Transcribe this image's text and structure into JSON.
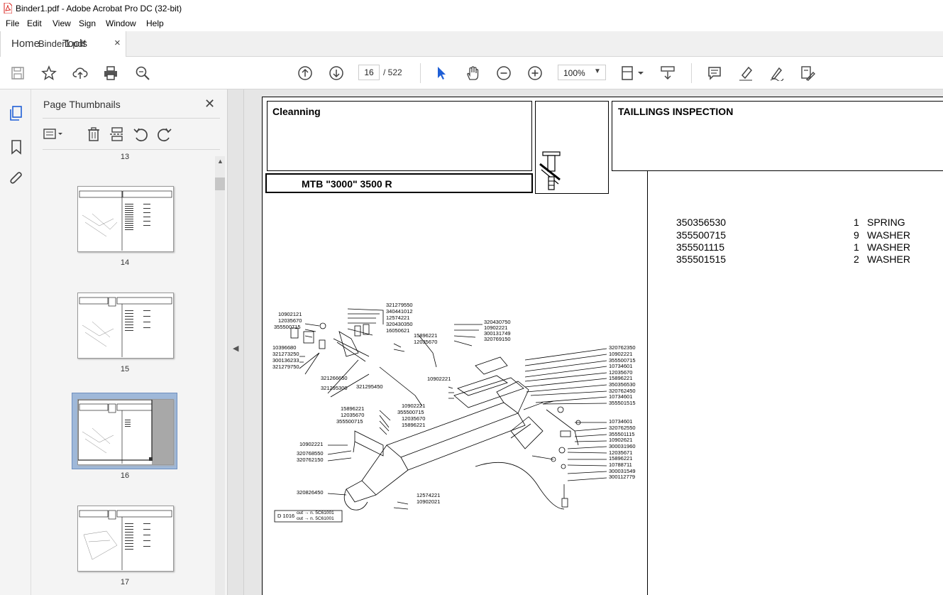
{
  "window": {
    "title": "Binder1.pdf - Adobe Acrobat Pro DC (32-bit)"
  },
  "menu": [
    "File",
    "Edit",
    "View",
    "Sign",
    "Window",
    "Help"
  ],
  "tabs": {
    "home": "Home",
    "tools": "Tools",
    "document": "Binder1.pdf",
    "close_glyph": "×"
  },
  "toolbar": {
    "current_page": "16",
    "total_pages": "/ 522",
    "zoom": "100%",
    "icons": [
      "save-icon",
      "star-icon",
      "upload-icon",
      "print-icon",
      "search-zoom-icon",
      "page-up-icon",
      "page-down-icon",
      "select-arrow-icon",
      "hand-icon",
      "zoom-out-icon",
      "zoom-in-icon",
      "fit-page-icon",
      "scroll-mode-icon",
      "comment-icon",
      "highlight-icon",
      "sign-icon",
      "redact-icon"
    ]
  },
  "leftrail": {
    "icons": [
      "page-thumbnails-icon",
      "bookmark-icon",
      "attachment-icon"
    ]
  },
  "thumbnails": {
    "title": "Page Thumbnails",
    "close_glyph": "✕",
    "pages": [
      {
        "label": "13"
      },
      {
        "label": "14"
      },
      {
        "label": "15"
      },
      {
        "label": "16",
        "selected": true
      },
      {
        "label": "17"
      }
    ]
  },
  "document": {
    "header_left": "Cleanning",
    "header_right": "TAILLINGS INSPECTION",
    "model": "MTB \"3000\" 3500 R",
    "parts": [
      {
        "code": "350356530",
        "qty": "1",
        "name": "SPRING"
      },
      {
        "code": "355500715",
        "qty": "9",
        "name": "WASHER"
      },
      {
        "code": "355501115",
        "qty": "1",
        "name": "WASHER"
      },
      {
        "code": "355501515",
        "qty": "2",
        "name": "WASHER"
      }
    ],
    "callouts_left": [
      "10902121",
      "12035670",
      "355500715",
      "10396680",
      "321273250",
      "300136233",
      "321279750",
      "321266650",
      "321295300"
    ],
    "callouts_top": [
      "321279550",
      "340441012",
      "12574221",
      "320430350",
      "16050621",
      "15896221",
      "12035670",
      "320430750",
      "10902221",
      "300131749",
      "320769150",
      "321295450",
      "10902221"
    ],
    "callouts_mid": [
      "15896221",
      "12035670",
      "355500715",
      "10902221",
      "355500715",
      "12035670",
      "15896221",
      "10902221",
      "320768550",
      "320762150",
      "320826450",
      "12574221",
      "10902021"
    ],
    "callouts_right": [
      "320762350",
      "10902221",
      "355500715",
      "10734601",
      "12035670",
      "15896221",
      "350356530",
      "320762450",
      "10734601",
      "355501515",
      "10734601",
      "320762550",
      "355501115",
      "10902621",
      "300031960",
      "12035671",
      "15896221",
      "10788711",
      "300031549",
      "300112779"
    ],
    "figure_ref": "D 1016",
    "figure_notes": [
      "out → n. 5C61001",
      "out → n. 5C61001"
    ]
  },
  "colors": {
    "acrobat_red": "#d9221c",
    "selected_thumb": "#9fb8d9"
  }
}
